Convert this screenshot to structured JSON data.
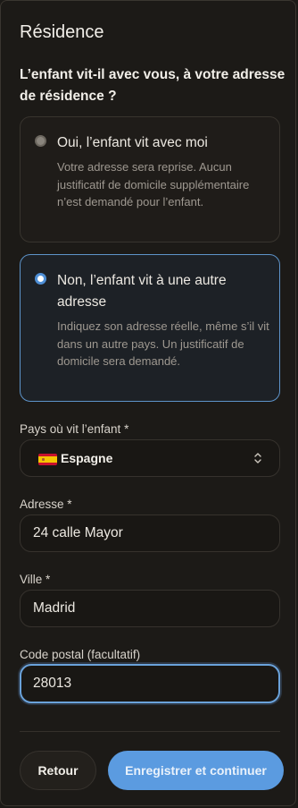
{
  "section_title": "Résidence",
  "question": "L’enfant vit-il avec vous, à votre adresse de résidence ?",
  "options": [
    {
      "title": "Oui, l’enfant vit avec moi",
      "description": "Votre adresse sera reprise. Aucun justificatif de domicile supplémentaire n’est demandé pour l’enfant.",
      "selected": false
    },
    {
      "title": "Non, l’enfant vit à une autre adresse",
      "description": "Indiquez son adresse réelle, même s’il vit dans un autre pays. Un justificatif de domicile sera demandé.",
      "selected": true
    }
  ],
  "country": {
    "label": "Pays où vit l’enfant *",
    "value": "Espagne",
    "flag_icon": "spain-flag-icon"
  },
  "address": {
    "label": "Adresse *",
    "value": "24 calle Mayor"
  },
  "city": {
    "label": "Ville *",
    "value": "Madrid"
  },
  "postal_code": {
    "label": "Code postal (facultatif)",
    "value": "28013"
  },
  "buttons": {
    "back": "Retour",
    "save": "Enregistrer et continuer"
  },
  "colors": {
    "accent": "#5b9be0",
    "selected_border": "#5d93c9",
    "background": "#1c1a17"
  }
}
